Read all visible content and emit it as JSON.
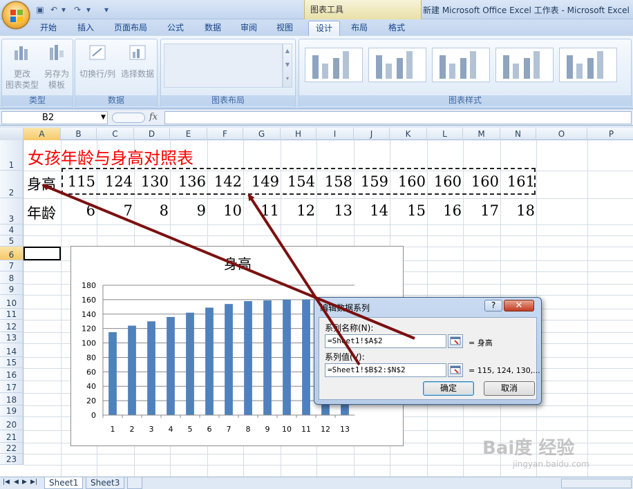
{
  "window": {
    "title": "新建 Microsoft Office Excel 工作表 - Microsoft Excel",
    "context_tools": "图表工具"
  },
  "tabs": [
    "开始",
    "插入",
    "页面布局",
    "公式",
    "数据",
    "审阅",
    "视图",
    "设计",
    "布局",
    "格式"
  ],
  "active_tab": "设计",
  "ribbon": {
    "type_group": {
      "label": "类型",
      "change_type": "更改\n图表类型",
      "save_template": "另存为\n模板"
    },
    "data_group": {
      "label": "数据",
      "switch_row_col": "切换行/列",
      "select_data": "选择数据"
    },
    "layout_group": {
      "label": "图表布局"
    },
    "styles_group": {
      "label": "图表样式"
    }
  },
  "formula_bar": {
    "name_box": "B2",
    "fx": "fx",
    "content": ""
  },
  "columns": [
    "A",
    "B",
    "C",
    "D",
    "E",
    "F",
    "G",
    "H",
    "I",
    "J",
    "K",
    "L",
    "M",
    "N",
    "O",
    "P"
  ],
  "rows": [
    "1",
    "2",
    "3",
    "4",
    "5",
    "6",
    "7",
    "8",
    "9",
    "10",
    "11",
    "12",
    "13",
    "14",
    "15",
    "16",
    "17",
    "18",
    "19",
    "20",
    "21",
    "22",
    "23"
  ],
  "sheet": {
    "title": "女孩年龄与身高对照表",
    "row2_label": "身高",
    "heights": [
      115,
      124,
      130,
      136,
      142,
      149,
      154,
      158,
      159,
      160,
      160,
      160,
      161
    ],
    "row3_label": "年龄",
    "ages": [
      6,
      7,
      8,
      9,
      10,
      11,
      12,
      13,
      14,
      15,
      16,
      17,
      18
    ]
  },
  "chart_data": {
    "type": "bar",
    "title": "身高",
    "categories": [
      "1",
      "2",
      "3",
      "4",
      "5",
      "6",
      "7",
      "8",
      "9",
      "10",
      "11",
      "12",
      "13"
    ],
    "values": [
      115,
      124,
      130,
      136,
      142,
      149,
      154,
      158,
      159,
      160,
      160,
      160,
      161
    ],
    "ylim": [
      0,
      180
    ],
    "yticks": [
      0,
      20,
      40,
      60,
      80,
      100,
      120,
      140,
      160,
      180
    ],
    "grid": true,
    "bar_color": "#4f81bd"
  },
  "dialog": {
    "title": "编辑数据系列",
    "help": "?",
    "close": "✕",
    "name_label": "系列名称(N):",
    "name_value": "=Sheet1!$A$2",
    "name_preview": "= 身高",
    "values_label": "系列值(V):",
    "values_value": "=Sheet1!$B$2:$N$2",
    "values_preview": "= 115, 124, 130,...",
    "ok": "确定",
    "cancel": "取消"
  },
  "sheet_tabs": [
    "Sheet1",
    "Sheet3"
  ],
  "active_sheet": "Sheet1",
  "watermark": {
    "main": "Bai度 经验",
    "sub": "jingyan.baidu.com"
  },
  "colors": {
    "title_red": "#ff0000",
    "arrow": "#7b1010",
    "accent": "#15428b"
  }
}
